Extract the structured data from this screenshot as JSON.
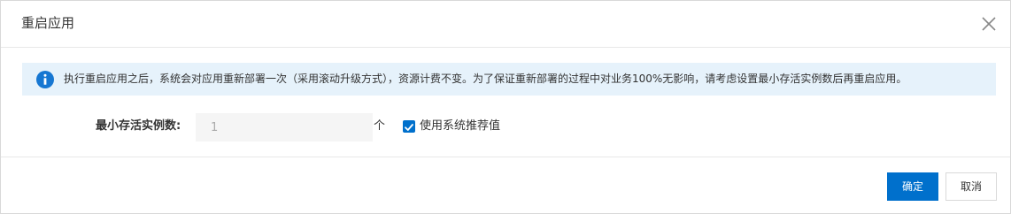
{
  "dialog": {
    "title": "重启应用",
    "close_icon": "close-icon"
  },
  "notice": {
    "icon": "info-icon",
    "icon_color": "#1677d2",
    "background": "#e6f2fb",
    "text": "执行重启应用之后，系统会对应用重新部署一次（采用滚动升级方式），资源计费不变。为了保证重新部署的过程中对业务100%无影响，请考虑设置最小存活实例数后再重启应用。"
  },
  "form": {
    "min_instances_label": "最小存活实例数:",
    "min_instances_value": "1",
    "unit": "个",
    "use_recommended_checked": true,
    "use_recommended_label": "使用系统推荐值"
  },
  "footer": {
    "confirm_label": "确定",
    "cancel_label": "取消",
    "primary_color": "#0070cc"
  }
}
